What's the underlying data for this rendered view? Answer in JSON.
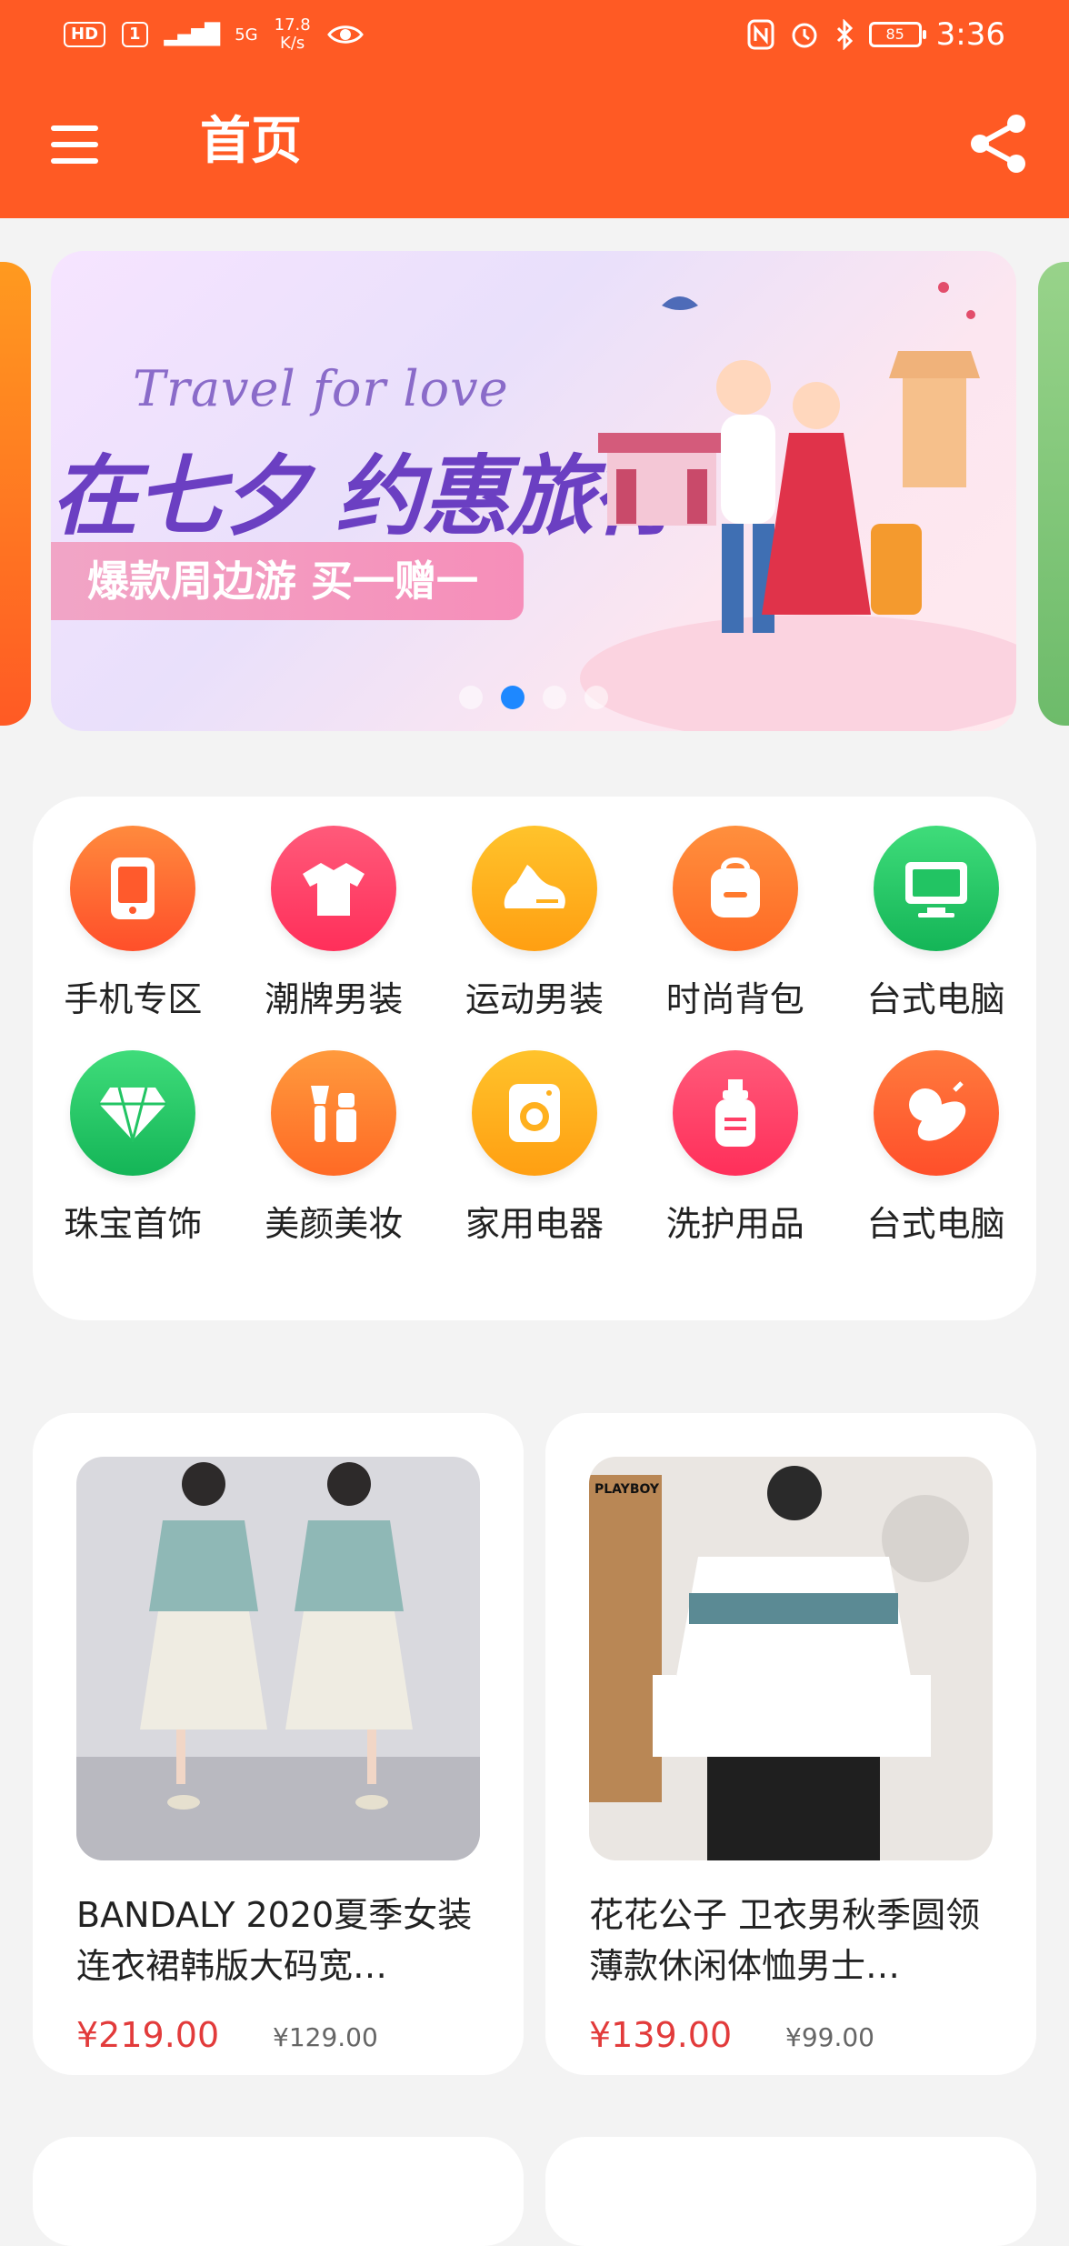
{
  "status_bar": {
    "hd": "HD",
    "sim": "1",
    "net": "5G",
    "speed_value": "17.8",
    "speed_unit": "K/s",
    "battery": "85",
    "time": "3:36"
  },
  "app_bar": {
    "title": "首页"
  },
  "banner": {
    "en_text": "Travel for love",
    "cn_text": "在七夕 约惠旅行",
    "ribbon_text": "爆款周边游 买一赠一",
    "page_count": 4,
    "active_index": 1
  },
  "categories": [
    {
      "label": "手机专区",
      "icon": "phone-icon",
      "color1": "#ff8a3d",
      "color2": "#ff4f2a"
    },
    {
      "label": "潮牌男装",
      "icon": "tshirt-icon",
      "color1": "#ff5a7a",
      "color2": "#ff2f5a"
    },
    {
      "label": "运动男装",
      "icon": "sneaker-icon",
      "color1": "#ffc32b",
      "color2": "#ff9f12"
    },
    {
      "label": "时尚背包",
      "icon": "backpack-icon",
      "color1": "#ff8f3d",
      "color2": "#ff6a25"
    },
    {
      "label": "台式电脑",
      "icon": "monitor-icon",
      "color1": "#3fdc7a",
      "color2": "#14b557"
    },
    {
      "label": "珠宝首饰",
      "icon": "diamond-icon",
      "color1": "#3fdc7a",
      "color2": "#14b557"
    },
    {
      "label": "美颜美妆",
      "icon": "cosmetics-icon",
      "color1": "#ff9a3d",
      "color2": "#ff6a25"
    },
    {
      "label": "家用电器",
      "icon": "washer-icon",
      "color1": "#ffc32b",
      "color2": "#ff9f12"
    },
    {
      "label": "洗护用品",
      "icon": "lotion-icon",
      "color1": "#ff5a7a",
      "color2": "#ff2f5a"
    },
    {
      "label": "台式电脑",
      "icon": "vegetable-icon",
      "color1": "#ff7a3d",
      "color2": "#ff4f2a"
    }
  ],
  "products": [
    {
      "name": "BANDALY 2020夏季女装连衣裙韩版大码宽…",
      "price": "¥219.00",
      "old_price": "¥129.00"
    },
    {
      "name": "花花公子 卫衣男秋季圆领薄款休闲体恤男士…",
      "price": "¥139.00",
      "old_price": "¥99.00",
      "brand_mark": "PLAYBOY"
    }
  ],
  "colors": {
    "brand": "#ff5a24",
    "price": "#e23b3b",
    "dot_active": "#1e88ff"
  }
}
